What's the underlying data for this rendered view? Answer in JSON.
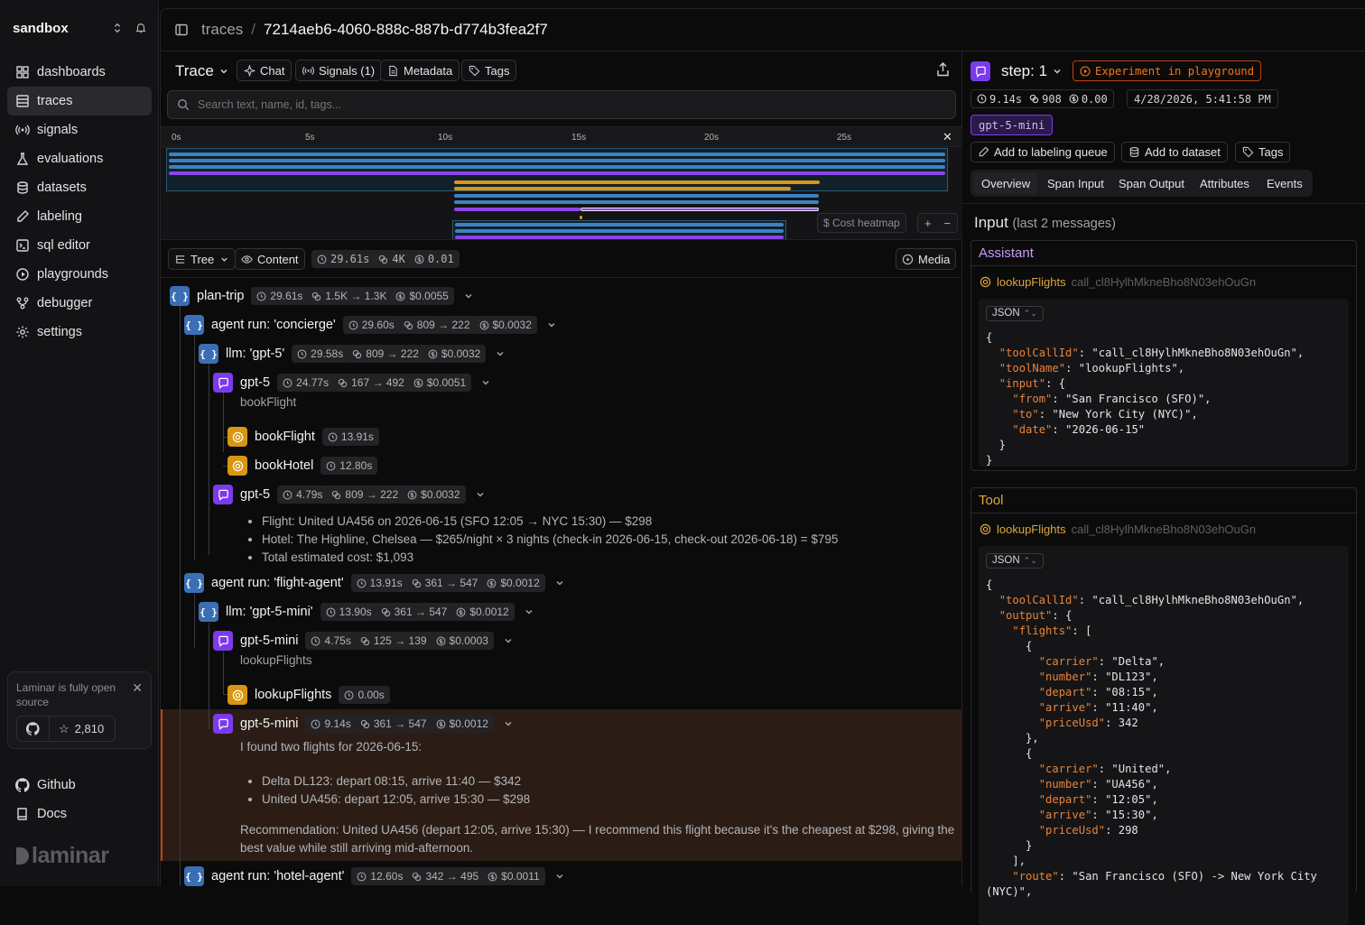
{
  "sidebar": {
    "workspace": "sandbox",
    "items": [
      {
        "label": "dashboards",
        "icon": "dashboard-icon"
      },
      {
        "label": "traces",
        "icon": "traces-icon",
        "active": true
      },
      {
        "label": "signals",
        "icon": "signal-icon"
      },
      {
        "label": "evaluations",
        "icon": "flask-icon"
      },
      {
        "label": "datasets",
        "icon": "database-icon"
      },
      {
        "label": "labeling",
        "icon": "pen-icon"
      },
      {
        "label": "sql editor",
        "icon": "terminal-icon"
      },
      {
        "label": "playgrounds",
        "icon": "play-icon"
      },
      {
        "label": "debugger",
        "icon": "branch-icon"
      },
      {
        "label": "settings",
        "icon": "gear-icon"
      }
    ],
    "promo": {
      "text": "Laminar is fully open source",
      "stars": "2,810"
    },
    "footer": [
      {
        "label": "Github",
        "icon": "github-icon"
      },
      {
        "label": "Docs",
        "icon": "book-icon"
      }
    ],
    "logo": "laminar"
  },
  "breadcrumb": {
    "parent": "traces",
    "separator": "/",
    "trace_id": "7214aeb6-4060-888c-887b-d774b3fea2f7"
  },
  "trace_panel": {
    "title": "Trace",
    "buttons": {
      "chat": "Chat",
      "signals": "Signals (1)",
      "metadata": "Metadata",
      "tags": "Tags"
    },
    "search_placeholder": "Search text, name, id, tags...",
    "timeline_ticks": [
      "0s",
      "5s",
      "10s",
      "15s",
      "20s",
      "25s"
    ],
    "cost_heatmap": "$ Cost heatmap",
    "view": {
      "tree": "Tree",
      "content": "Content",
      "media": "Media"
    },
    "stats": {
      "duration": "29.61s",
      "tokens": "4K",
      "cost": "0.01"
    }
  },
  "tree": [
    {
      "name": "plan-trip",
      "kind": "default",
      "duration": "29.61s",
      "tokens": "1.5K → 1.3K",
      "cost": "$0.0055"
    },
    {
      "name": "agent run: 'concierge'",
      "kind": "default",
      "duration": "29.60s",
      "tokens": "809 → 222",
      "cost": "$0.0032"
    },
    {
      "name": "llm: 'gpt-5'",
      "kind": "default",
      "duration": "29.58s",
      "tokens": "809 → 222",
      "cost": "$0.0032"
    },
    {
      "name": "gpt-5",
      "kind": "llm",
      "duration": "24.77s",
      "tokens": "167 → 492",
      "cost": "$0.0051",
      "sub": "bookFlight"
    },
    {
      "name": "bookFlight",
      "kind": "tool",
      "duration": "13.91s"
    },
    {
      "name": "bookHotel",
      "kind": "tool",
      "duration": "12.80s"
    },
    {
      "name": "gpt-5",
      "kind": "llm",
      "duration": "4.79s",
      "tokens": "809 → 222",
      "cost": "$0.0032",
      "bullets": [
        "Flight: United UA456 on 2026-06-15 (SFO 12:05 → NYC 15:30) — $298",
        "Hotel: The Highline, Chelsea — $265/night × 3 nights (check-in 2026-06-15, check-out 2026-06-18) = $795",
        "Total estimated cost: $1,093"
      ]
    },
    {
      "name": "agent run: 'flight-agent'",
      "kind": "default",
      "duration": "13.91s",
      "tokens": "361 → 547",
      "cost": "$0.0012"
    },
    {
      "name": "llm: 'gpt-5-mini'",
      "kind": "default",
      "duration": "13.90s",
      "tokens": "361 → 547",
      "cost": "$0.0012"
    },
    {
      "name": "gpt-5-mini",
      "kind": "llm",
      "duration": "4.75s",
      "tokens": "125 → 139",
      "cost": "$0.0003",
      "sub": "lookupFlights"
    },
    {
      "name": "lookupFlights",
      "kind": "tool",
      "duration": "0.00s"
    },
    {
      "name": "gpt-5-mini",
      "kind": "llm",
      "duration": "9.14s",
      "tokens": "361 → 547",
      "cost": "$0.0012",
      "selected": true,
      "intro": "I found two flights for 2026-06-15:",
      "bullets": [
        "Delta DL123: depart 08:15, arrive 11:40 — $342",
        "United UA456: depart 12:05, arrive 15:30 — $298"
      ],
      "outro": "Recommendation: United UA456 (depart 12:05, arrive 15:30) — I recommend this flight because it's the cheapest at $298, giving the best value while still arriving mid-afternoon."
    },
    {
      "name": "agent run: 'hotel-agent'",
      "kind": "default",
      "duration": "12.60s",
      "tokens": "342 → 495",
      "cost": "$0.0011"
    }
  ],
  "span": {
    "name": "step: 1",
    "experiment": "Experiment in playground",
    "duration": "9.14s",
    "tokens": "908",
    "cost": "0.00",
    "timestamp": "4/28/2026, 5:41:58 PM",
    "model": "gpt-5-mini",
    "actions": {
      "labeling": "Add to labeling queue",
      "dataset": "Add to dataset",
      "tags": "Tags"
    },
    "tabs": [
      "Overview",
      "Span Input",
      "Span Output",
      "Attributes",
      "Events"
    ],
    "active_tab": "Overview",
    "input_title": "Input",
    "input_sub": "(last 2 messages)",
    "messages": [
      {
        "role": "Assistant",
        "tool_name": "lookupFlights",
        "call_id": "call_cl8HylhMkneBho8N03ehOuGn",
        "format": "JSON"
      },
      {
        "role": "Tool",
        "tool_name": "lookupFlights",
        "call_id": "call_cl8HylhMkneBho8N03ehOuGn",
        "format": "JSON"
      }
    ]
  },
  "colors": {
    "accent_purple": "#7c3aed",
    "accent_blue": "#3b6fb5",
    "accent_orange": "#e8833a",
    "tool_yellow": "#d89612"
  }
}
